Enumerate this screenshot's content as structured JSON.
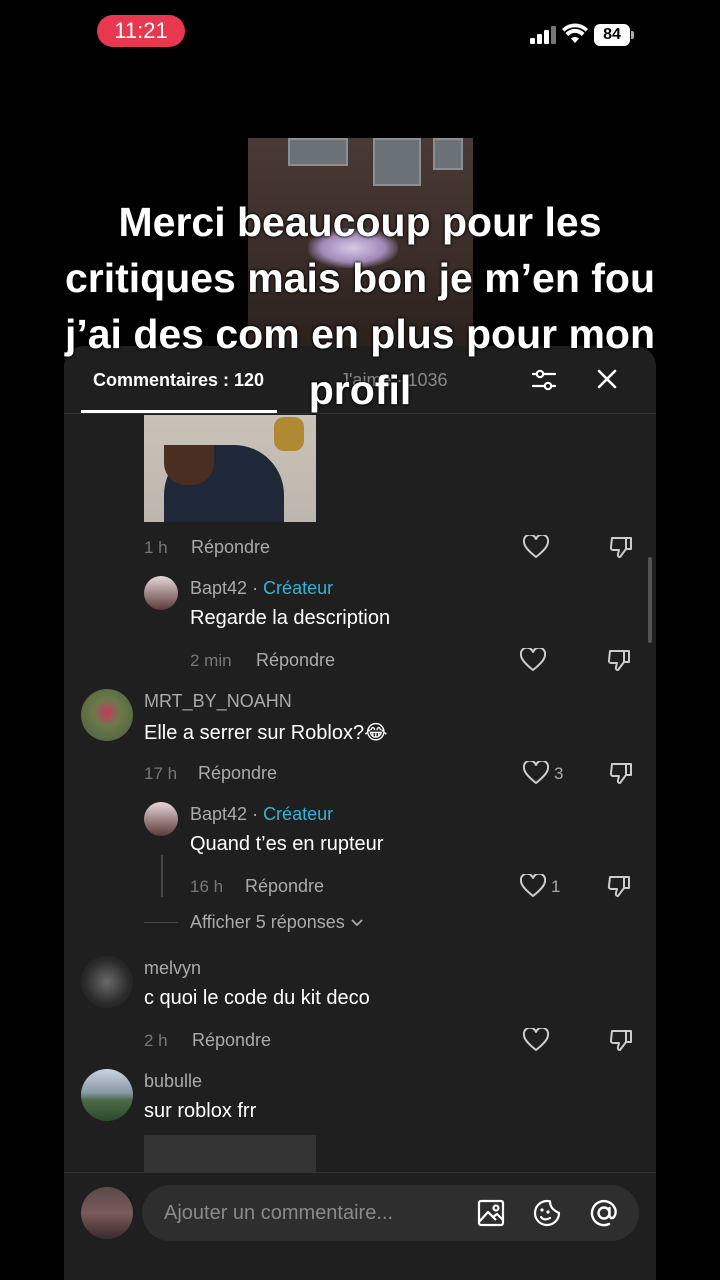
{
  "status_bar": {
    "time": "11:21",
    "battery": "84"
  },
  "caption": "Merci beaucoup pour les critiques mais bon je m’en fou j’ai des com en plus pour mon profil",
  "header": {
    "tab_comments": "Commentaires : 120",
    "tab_likes": "J'aime · 1036"
  },
  "comments": [
    {
      "time": "1 h",
      "reply": "Répondre"
    },
    {
      "user": "Bapt42",
      "sep": " · ",
      "badge": "Créateur",
      "text": "Regarde la description",
      "time": "2 min",
      "reply": "Répondre"
    },
    {
      "user": "MRT_BY_NOAHN",
      "text": "Elle a serrer sur Roblox?😂",
      "time": "17 h",
      "reply": "Répondre",
      "likes": "3"
    },
    {
      "user": "Bapt42",
      "sep": " · ",
      "badge": "Créateur",
      "text": "Quand t’es en rupteur",
      "time": "16 h",
      "reply": "Répondre",
      "likes": "1"
    },
    {
      "more": "Afficher 5 réponses"
    },
    {
      "user": "melvyn",
      "text": "c quoi le code du kit deco",
      "time": "2 h",
      "reply": "Répondre"
    },
    {
      "user": "bubulle",
      "text": "sur roblox frr"
    }
  ],
  "input": {
    "placeholder": "Ajouter un commentaire..."
  },
  "colors": {
    "creator": "#2fb5d6",
    "time_pill": "#e8384f",
    "sheet_bg": "#1f1f1f"
  }
}
